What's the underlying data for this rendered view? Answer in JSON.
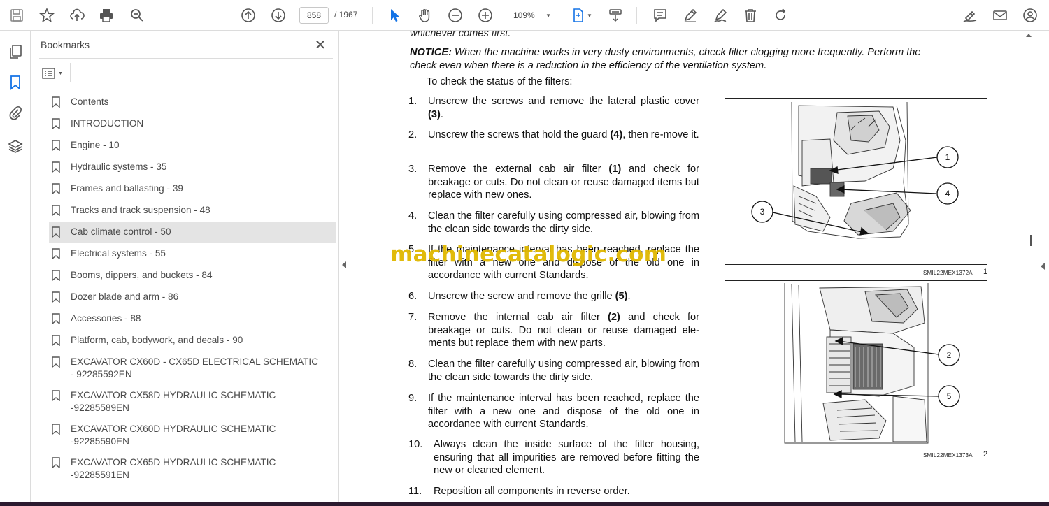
{
  "toolbar": {
    "page_current": "858",
    "page_total": "/ 1967",
    "zoom": "109%"
  },
  "bookmarks": {
    "header": "Bookmarks",
    "close_glyph": "✕",
    "items": [
      {
        "label": "Contents"
      },
      {
        "label": "INTRODUCTION"
      },
      {
        "label": "Engine - 10"
      },
      {
        "label": "Hydraulic systems - 35"
      },
      {
        "label": "Frames and ballasting - 39"
      },
      {
        "label": "Tracks and track suspension - 48"
      },
      {
        "label": "Cab climate control - 50",
        "selected": true
      },
      {
        "label": "Electrical systems - 55"
      },
      {
        "label": "Booms, dippers, and buckets - 84"
      },
      {
        "label": "Dozer blade and arm - 86"
      },
      {
        "label": "Accessories - 88"
      },
      {
        "label": "Platform, cab, bodywork, and decals - 90"
      },
      {
        "label": "EXCAVATOR CX60D - CX65D ELECTRICAL SCHEMATIC - 92285592EN"
      },
      {
        "label": "EXCAVATOR CX58D HYDRAULIC SCHEMATIC -92285589EN"
      },
      {
        "label": "EXCAVATOR CX60D HYDRAULIC SCHEMATIC -92285590EN"
      },
      {
        "label": "EXCAVATOR CX65D HYDRAULIC SCHEMATIC -92285591EN"
      }
    ]
  },
  "document": {
    "cut_line": "whichever comes first.",
    "notice_label": "NOTICE:",
    "notice_text": " When the machine works in very dusty environments, check filter clogging more frequently. Perform the check even when there is a reduction in the efficiency of the ventilation system.",
    "intro": "To check the status of the filters:",
    "steps": [
      {
        "num": "1.",
        "text": "Unscrew the screws and remove the lateral plastic cover (3)."
      },
      {
        "num": "2.",
        "text": "Unscrew the screws that hold the guard (4), then re-move it."
      },
      {
        "num": "3.",
        "text": "Remove the external cab air filter (1) and check for breakage or cuts.  Do not clean or reuse damaged items but replace with new ones."
      },
      {
        "num": "4.",
        "text": "Clean the filter carefully using compressed air, blowing from the clean side towards the dirty side."
      },
      {
        "num": "5.",
        "text": "If the maintenance interval has been reached, replace the filter with a new one and dispose of the old one in accordance with current Standards."
      },
      {
        "num": "6.",
        "text": "Unscrew the screw and remove the grille (5)."
      },
      {
        "num": "7.",
        "text": "Remove the internal cab air filter (2) and check for breakage or cuts. Do not clean or reuse damaged ele-ments but replace them with new parts."
      },
      {
        "num": "8.",
        "text": "Clean the filter carefully using compressed air, blowing from the clean side towards the dirty side."
      },
      {
        "num": "9.",
        "text": "If the maintenance interval has been reached, replace the filter with a new one and dispose of the old one in accordance with current Standards."
      },
      {
        "num": "10.",
        "text": "Always clean the inside surface of the filter housing, ensuring that all impurities are removed before fitting the new or cleaned element."
      },
      {
        "num": "11.",
        "text": "Reposition all components in reverse order."
      }
    ],
    "figures": [
      {
        "code": "SMIL22MEX1372A",
        "number": "1",
        "callouts": [
          "1",
          "4",
          "3"
        ]
      },
      {
        "code": "SMIL22MEX1373A",
        "number": "2",
        "callouts": [
          "2",
          "5"
        ]
      }
    ],
    "watermark": "machinecatalogic.com"
  },
  "icons": {
    "toolbar": [
      "save-icon",
      "star-icon",
      "upload-cloud-icon",
      "print-icon",
      "zoom-search-icon",
      "page-up-icon",
      "page-down-icon",
      "select-arrow-icon",
      "hand-icon",
      "zoom-out-icon",
      "zoom-in-icon",
      "fit-page-icon",
      "scroll-mode-icon",
      "comment-icon",
      "highlight-pen-icon",
      "sign-icon",
      "delete-icon",
      "rotate-icon",
      "fill-sign-icon",
      "email-icon",
      "account-icon"
    ],
    "rail": [
      "pages-icon",
      "bookmarks-icon",
      "attachments-icon",
      "layers-icon"
    ]
  },
  "colors": {
    "accent": "#1473e6",
    "selected_row": "#e4e4e4",
    "watermark": "#e0b800"
  }
}
